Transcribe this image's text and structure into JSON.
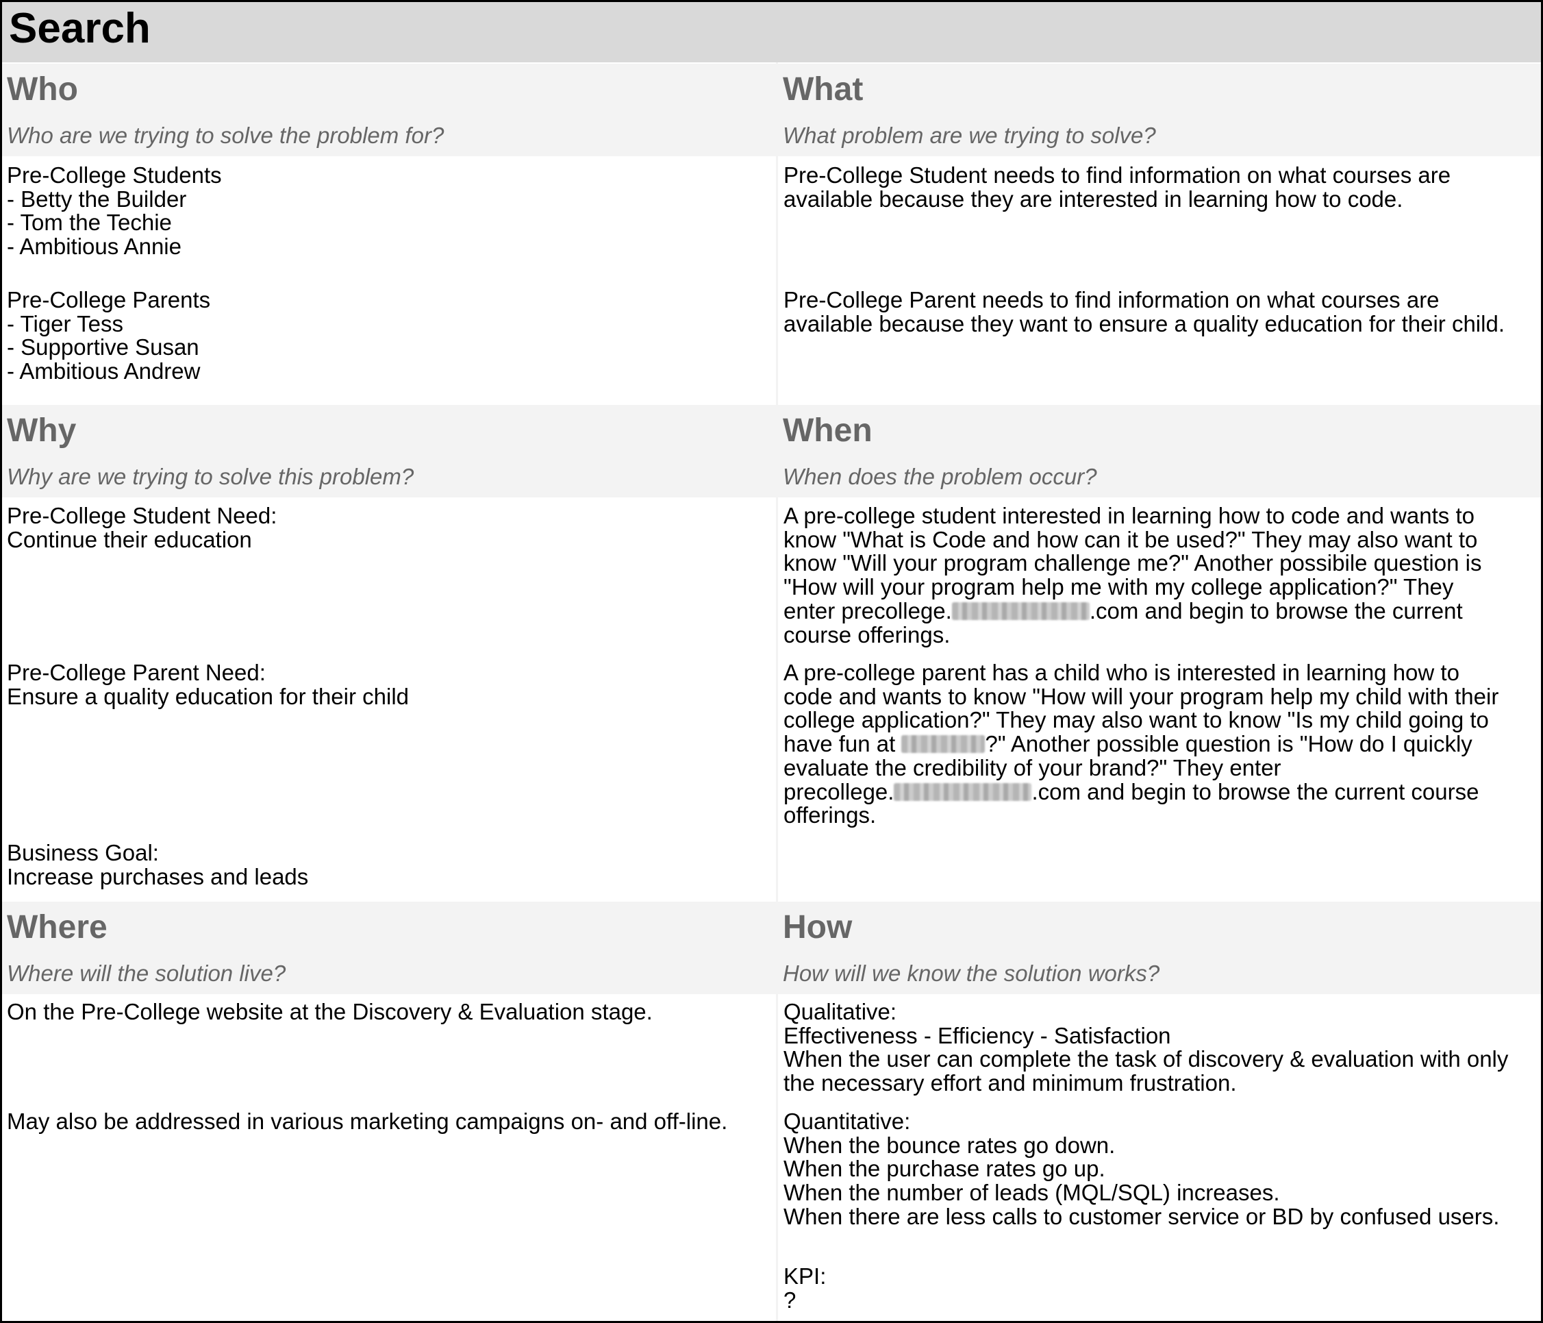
{
  "page": {
    "title": "Search"
  },
  "who": {
    "title": "Who",
    "subtitle": "Who are we trying to solve the problem for?",
    "block1": "Pre-College Students\n- Betty the Builder\n- Tom the Techie\n- Ambitious Annie",
    "block2": "Pre-College Parents\n- Tiger Tess\n- Supportive Susan\n- Ambitious Andrew"
  },
  "what": {
    "title": "What",
    "subtitle": "What problem are we trying to solve?",
    "block1": "Pre-College Student needs to find information on what courses are\navailable because they are interested in learning how to code.",
    "block2": "Pre-College Parent needs to find information on what courses are\navailable because they want to ensure a quality education for their child."
  },
  "why": {
    "title": "Why",
    "subtitle": "Why are we trying to solve this problem?",
    "block1": "Pre-College Student Need:\nContinue their education",
    "block2": "Pre-College Parent Need:\nEnsure a quality education for their child",
    "block3": "Business Goal:\nIncrease purchases and leads"
  },
  "when": {
    "title": "When",
    "subtitle": "When does the problem occur?",
    "block1_lines": [
      "A pre-college student interested in learning how to code and wants to",
      "know \"What is Code and how can it be used?\" They may also want to",
      "know \"Will your program challenge me?\" Another possibile question is",
      "\"How will your program help me with my college application?\" They"
    ],
    "block1_enter_prefix": "enter precollege.",
    "block1_enter_suffix": ".com and begin to browse the current",
    "block1_last_line": "course offerings.",
    "block2_lines": [
      "A pre-college parent has a child who is interested in learning how to",
      "code and wants to know \"How will your program help my child with their",
      "college application?\" They may also want to know \"Is my child going to"
    ],
    "block2_fun_prefix": "have fun at ",
    "block2_fun_suffix": "?\" Another possible question is \"How do I quickly",
    "block2_mid_line": "evaluate the credibility of your brand?\" They enter",
    "block2_url_prefix": "precollege.",
    "block2_url_suffix": ".com and begin to browse the current course",
    "block2_last_line": "offerings."
  },
  "where": {
    "title": "Where",
    "subtitle": "Where will the solution live?",
    "block1": "On the Pre-College website at the Discovery & Evaluation stage.",
    "block2": "May also be addressed in various marketing campaigns on- and off-line."
  },
  "how": {
    "title": "How",
    "subtitle": "How will we know the solution works?",
    "block1": "Qualitative:\nEffectiveness - Efficiency - Satisfaction\nWhen the user can complete the task of discovery & evaluation with only\nthe necessary effort and minimum frustration.",
    "block2": "Quantitative:\nWhen the bounce rates go down.\nWhen the purchase rates go up.\nWhen the number of leads (MQL/SQL) increases.\nWhen there are less calls to customer service or BD by confused users.",
    "block3": "KPI:\n?"
  }
}
